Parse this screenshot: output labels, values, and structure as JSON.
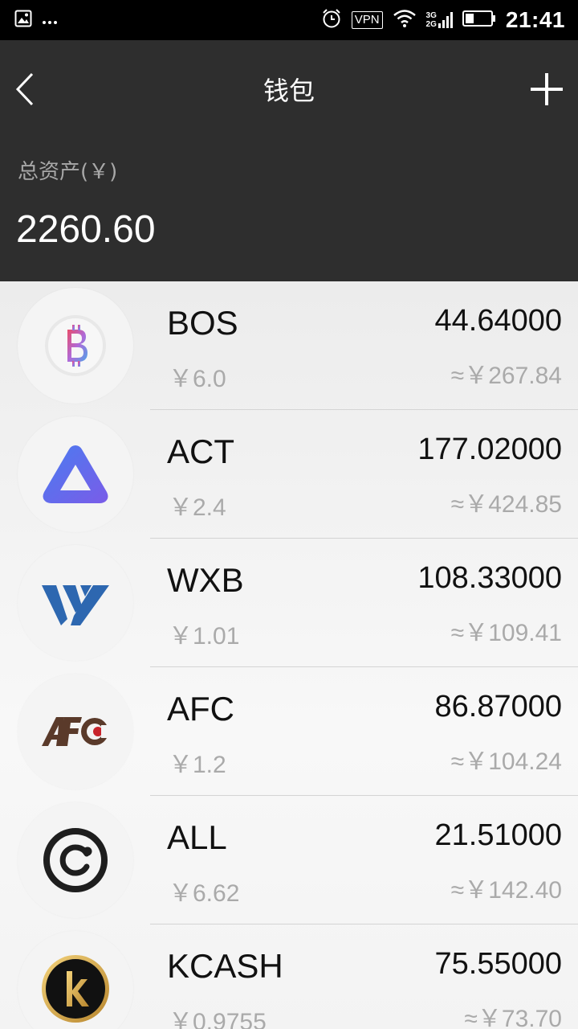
{
  "status_bar": {
    "time": "21:41",
    "vpn": "VPN",
    "network_top": "3G",
    "network_bottom": "2G"
  },
  "header": {
    "title": "钱包",
    "total_label": "总资产(￥)",
    "total_value": "2260.60"
  },
  "coins": [
    {
      "symbol": "BOS",
      "price": "￥6.0",
      "amount": "44.64000",
      "value": "≈￥267.84",
      "icon": "bitcoin-b-icon"
    },
    {
      "symbol": "ACT",
      "price": "￥2.4",
      "amount": "177.02000",
      "value": "≈￥424.85",
      "icon": "triangle-icon"
    },
    {
      "symbol": "WXB",
      "price": "￥1.01",
      "amount": "108.33000",
      "value": "≈￥109.41",
      "icon": "wxb-logo-icon"
    },
    {
      "symbol": "AFC",
      "price": "￥1.2",
      "amount": "86.87000",
      "value": "≈￥104.24",
      "icon": "afc-logo-icon"
    },
    {
      "symbol": "ALL",
      "price": "￥6.62",
      "amount": "21.51000",
      "value": "≈￥142.40",
      "icon": "ring-logo-icon"
    },
    {
      "symbol": "KCASH",
      "price": "￥0.9755",
      "amount": "75.55000",
      "value": "≈￥73.70",
      "icon": "kcash-k-icon"
    }
  ],
  "colors": {
    "header_bg": "#2e2e2e",
    "status_bar_bg": "#000000",
    "muted_text": "#aaaaaa"
  }
}
